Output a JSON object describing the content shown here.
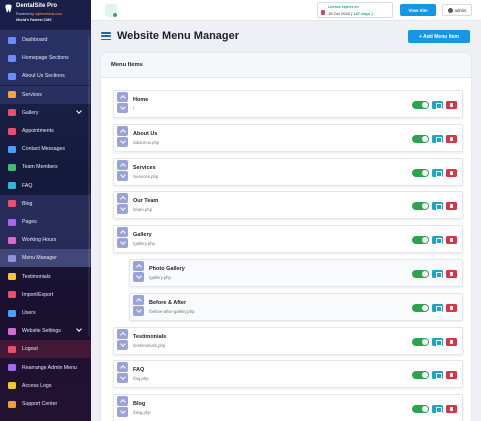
{
  "brand": {
    "title": "DentalSite Pro",
    "powered_prefix": "Powered by ",
    "powered_link": "mythreebeds.com",
    "tagline": "World's Fastest CMS"
  },
  "sidebar": {
    "items": [
      {
        "label": "Dashboard",
        "icon": "dashboard-icon",
        "color": "#6a8cff",
        "style": "section"
      },
      {
        "label": "Homepage Sections",
        "icon": "home-icon",
        "color": "#6a8cff",
        "style": "section"
      },
      {
        "label": "About Us Sections",
        "icon": "info-icon",
        "color": "#6a8cff",
        "style": "section"
      },
      {
        "label": "Services",
        "icon": "tooth-icon",
        "color": "#f7a531",
        "style": "section"
      },
      {
        "label": "Gallery",
        "icon": "images-icon",
        "color": "#ef4d6b",
        "caret": true
      },
      {
        "label": "Appointments",
        "icon": "calendar-icon",
        "color": "#ef4d6b"
      },
      {
        "label": "Contact Messages",
        "icon": "envelope-icon",
        "color": "#4aa0ff"
      },
      {
        "label": "Team Members",
        "icon": "users-icon",
        "color": "#3fbf6f"
      },
      {
        "label": "FAQ",
        "icon": "question-icon",
        "color": "#35b6d8"
      },
      {
        "label": "Blog",
        "icon": "blog-icon",
        "color": "#ef4d6b",
        "style": "section"
      },
      {
        "label": "Pages",
        "icon": "file-icon",
        "color": "#a868f0",
        "style": "section"
      },
      {
        "label": "Working Hours",
        "icon": "clock-icon",
        "color": "#d86bd0",
        "style": "section"
      },
      {
        "label": "Menu Manager",
        "icon": "list-icon",
        "color": "#8b94d8",
        "style": "active"
      },
      {
        "label": "Testimonials",
        "icon": "star-icon",
        "color": "#f7c531"
      },
      {
        "label": "Import/Export",
        "icon": "exchange-icon",
        "color": "#ef4d6b"
      },
      {
        "label": "Users",
        "icon": "user-icon",
        "color": "#4aa0ff"
      },
      {
        "label": "Website Settings",
        "icon": "cog-icon",
        "color": "#d86bd0",
        "caret": true
      },
      {
        "label": "Logout",
        "icon": "logout-icon",
        "color": "#ef4d6b",
        "style": "dark"
      },
      {
        "label": "Rearrange Admin Menu",
        "icon": "sort-icon",
        "color": "#a868f0"
      },
      {
        "label": "Access Logs",
        "icon": "shield-icon",
        "color": "#f7c531"
      },
      {
        "label": "Support Center",
        "icon": "lifebuoy-icon",
        "color": "#f0a030"
      }
    ]
  },
  "topbar": {
    "license_label": "License expires on",
    "license_date": "15 Oct 2026",
    "license_days": "( 187 days )",
    "view_site": "View Site",
    "user": "admin"
  },
  "page": {
    "title": "Website Menu Manager",
    "add_button": "+ Add Menu Item",
    "card_title": "Menu Items"
  },
  "menu_items": [
    {
      "name": "Home",
      "url": "/",
      "child": false,
      "enabled": true
    },
    {
      "name": "About Us",
      "url": "/about-us.php",
      "child": false,
      "enabled": true
    },
    {
      "name": "Services",
      "url": "/services.php",
      "child": false,
      "enabled": true
    },
    {
      "name": "Our Team",
      "url": "/team.php",
      "child": false,
      "enabled": true
    },
    {
      "name": "Gallery",
      "url": "/gallery.php",
      "child": false,
      "enabled": true
    },
    {
      "name": "Photo Gallery",
      "url": "/gallery.php",
      "child": true,
      "enabled": true
    },
    {
      "name": "Before & After",
      "url": "/before-after-gallery.php",
      "child": true,
      "enabled": true
    },
    {
      "name": "Testimonials",
      "url": "/testimonials.php",
      "child": false,
      "enabled": true
    },
    {
      "name": "FAQ",
      "url": "/faq.php",
      "child": false,
      "enabled": true
    },
    {
      "name": "Blog",
      "url": "/blog.php",
      "child": false,
      "enabled": true
    }
  ]
}
